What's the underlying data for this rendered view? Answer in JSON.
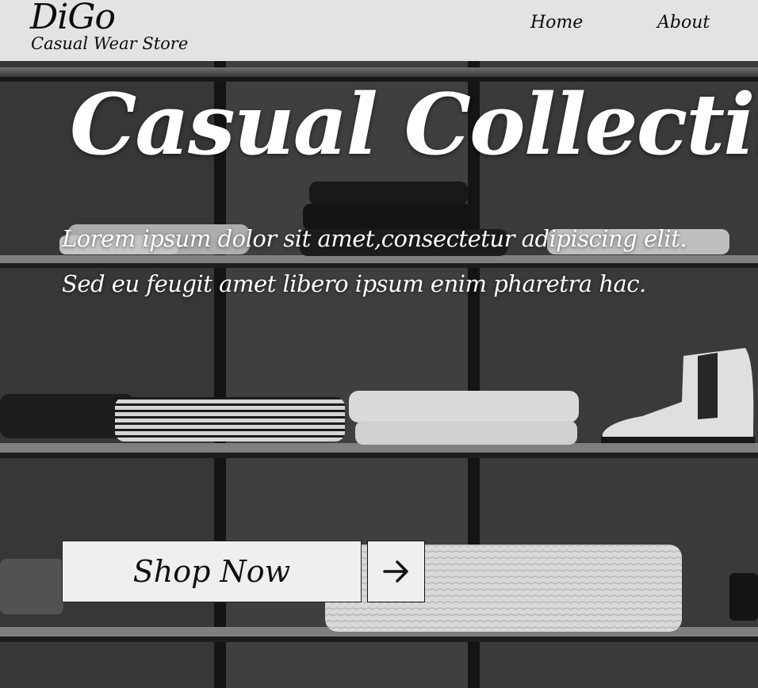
{
  "header": {
    "brand": "DiGo",
    "tagline": "Casual Wear Store",
    "nav": [
      {
        "label": "Home"
      },
      {
        "label": "About"
      }
    ]
  },
  "hero": {
    "title": "Casual Collectin",
    "text_lines": [
      "Lorem ipsum dolor sit amet,consectetur adipiscing elit.",
      "Sed eu feugit amet libero ipsum enim pharetra hac."
    ],
    "shop_button": "Shop Now",
    "arrow_icon": "arrow-right-icon",
    "background": "shelves-with-folded-clothes-and-boot"
  },
  "colors": {
    "header_bg": "#e1e4e1",
    "button_bg": "#efefef",
    "text_dark": "#0c0c0c",
    "hero_text": "#ffffff"
  }
}
